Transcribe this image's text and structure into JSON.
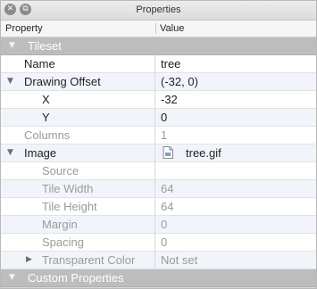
{
  "window": {
    "title": "Properties",
    "close_glyph": "✕",
    "float_glyph": "⧉"
  },
  "header": {
    "property": "Property",
    "value": "Value"
  },
  "arrows": {
    "expanded": "▼",
    "collapsed": "▶"
  },
  "rows": {
    "tileset": {
      "label": "Tileset"
    },
    "name": {
      "label": "Name",
      "value": "tree"
    },
    "offset": {
      "label": "Drawing Offset",
      "value": "(-32, 0)"
    },
    "x": {
      "label": "X",
      "value": "-32"
    },
    "y": {
      "label": "Y",
      "value": "0"
    },
    "columns": {
      "label": "Columns",
      "value": "1"
    },
    "image": {
      "label": "Image",
      "value": "tree.gif",
      "icon": "image-file-icon"
    },
    "source": {
      "label": "Source",
      "value": ""
    },
    "tile_width": {
      "label": "Tile Width",
      "value": "64"
    },
    "tile_height": {
      "label": "Tile Height",
      "value": "64"
    },
    "margin": {
      "label": "Margin",
      "value": "0"
    },
    "spacing": {
      "label": "Spacing",
      "value": "0"
    },
    "transparent": {
      "label": "Transparent Color",
      "value": "Not set"
    },
    "custom": {
      "label": "Custom Properties"
    }
  },
  "colors": {
    "group_row": "#bdbdbd",
    "alt_row": "#f1f5fb",
    "readonly_text": "#9a9a9a"
  }
}
